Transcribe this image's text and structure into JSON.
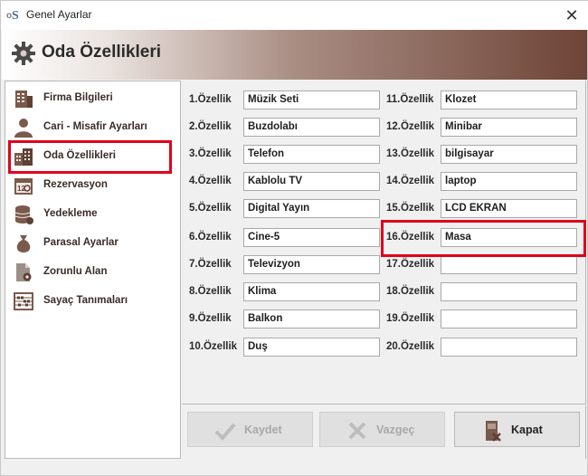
{
  "window": {
    "title": "Genel Ayarlar",
    "close_label": "✕"
  },
  "header": {
    "title": "Oda Özellikleri"
  },
  "sidebar": {
    "items": [
      {
        "label": "Firma Bilgileri",
        "icon": "building-icon"
      },
      {
        "label": "Cari - Misafir Ayarları",
        "icon": "user-icon"
      },
      {
        "label": "Oda Özellikleri",
        "icon": "hotel-icon",
        "selected": true
      },
      {
        "label": "Rezervasyon",
        "icon": "calendar-icon"
      },
      {
        "label": "Yedekleme",
        "icon": "database-icon"
      },
      {
        "label": "Parasal Ayarlar",
        "icon": "money-bag-icon"
      },
      {
        "label": "Zorunlu Alan",
        "icon": "document-gear-icon"
      },
      {
        "label": "Sayaç Tanımaları",
        "icon": "abacus-icon"
      }
    ]
  },
  "features": {
    "left": [
      {
        "label": "1.Özellik",
        "value": "Müzik Seti"
      },
      {
        "label": "2.Özellik",
        "value": "Buzdolabı"
      },
      {
        "label": "3.Özellik",
        "value": "Telefon"
      },
      {
        "label": "4.Özellik",
        "value": "Kablolu TV"
      },
      {
        "label": "5.Özellik",
        "value": "Digital Yayın"
      },
      {
        "label": "6.Özellik",
        "value": "Cine-5"
      },
      {
        "label": "7.Özellik",
        "value": "Televizyon"
      },
      {
        "label": "8.Özellik",
        "value": "Klima"
      },
      {
        "label": "9.Özellik",
        "value": "Balkon"
      },
      {
        "label": "10.Özellik",
        "value": "Duş"
      }
    ],
    "right": [
      {
        "label": "11.Özellik",
        "value": "Klozet"
      },
      {
        "label": "12.Özellik",
        "value": "Minibar"
      },
      {
        "label": "13.Özellik",
        "value": "bilgisayar"
      },
      {
        "label": "14.Özellik",
        "value": "laptop"
      },
      {
        "label": "15.Özellik",
        "value": "LCD EKRAN"
      },
      {
        "label": "16.Özellik",
        "value": "Masa"
      },
      {
        "label": "17.Özellik",
        "value": ""
      },
      {
        "label": "18.Özellik",
        "value": ""
      },
      {
        "label": "19.Özellik",
        "value": ""
      },
      {
        "label": "20.Özellik",
        "value": ""
      }
    ]
  },
  "buttons": {
    "save": {
      "label": "Kaydet",
      "enabled": false
    },
    "cancel": {
      "label": "Vazgeç",
      "enabled": false
    },
    "close": {
      "label": "Kapat",
      "enabled": true
    }
  },
  "colors": {
    "brand_brown": "#6e4437",
    "icon_brown": "#7a5a4c",
    "highlight_red": "#e0001b"
  }
}
